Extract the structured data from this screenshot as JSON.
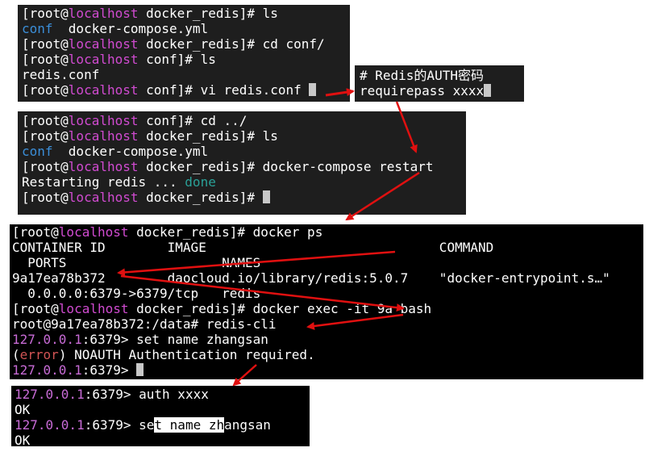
{
  "prompt": {
    "root_open": "[root@",
    "host": "localhost",
    "dir_redis": " docker_redis]# ",
    "dir_conf": " conf]# "
  },
  "t1": {
    "cmd1": "ls",
    "ls1_dir": "conf",
    "ls1_file": "  docker-compose.yml",
    "cmd2": "cd conf/",
    "cmd3": "ls",
    "out3": "redis.conf",
    "cmd4": "vi redis.conf "
  },
  "t2": {
    "comment": "# Redis的AUTH密码",
    "setting": "requirepass xxxx"
  },
  "t3": {
    "cmd1": "cd ../",
    "cmd2": "ls",
    "ls_dir": "conf",
    "ls_file": "  docker-compose.yml",
    "cmd3": "docker-compose restart",
    "restart_text": "Restarting redis ... ",
    "restart_done": "done",
    "cmd4": ""
  },
  "t4": {
    "cmd1": "docker ps",
    "header1": "CONTAINER ID        IMAGE                              COMMAND",
    "header2": "  PORTS                    NAMES",
    "row1": "9a17ea78b372        daocloud.io/library/redis:5.0.7    \"docker-entrypoint.s…\"",
    "row2": "  0.0.0.0:6379->6379/tcp   redis",
    "cmd2": "docker exec -it 9a bash",
    "shell": "root@9a17ea78b372:/data# redis-cli",
    "rprompt": "127.0.0.1",
    "rport": ":6379> ",
    "rcmd1": "set name zhangsan",
    "err_open": "(",
    "err_word": "error",
    "err_rest": ") NOAUTH Authentication required.",
    "rport_last": ":6379> "
  },
  "t5": {
    "rprompt": "127.0.0.1",
    "rport": ":6379> ",
    "cmd1": "auth xxxx",
    "ok1": "OK",
    "cmd2_a": "se",
    "cmd2_hl": "t name zh",
    "cmd2_b": "angsan",
    "ok2": "OK"
  },
  "colors": {
    "host": "#d14bd1",
    "dir": "#3b8ed8",
    "done": "#2aa198",
    "error": "#d15454",
    "arrow": "#e01010"
  }
}
